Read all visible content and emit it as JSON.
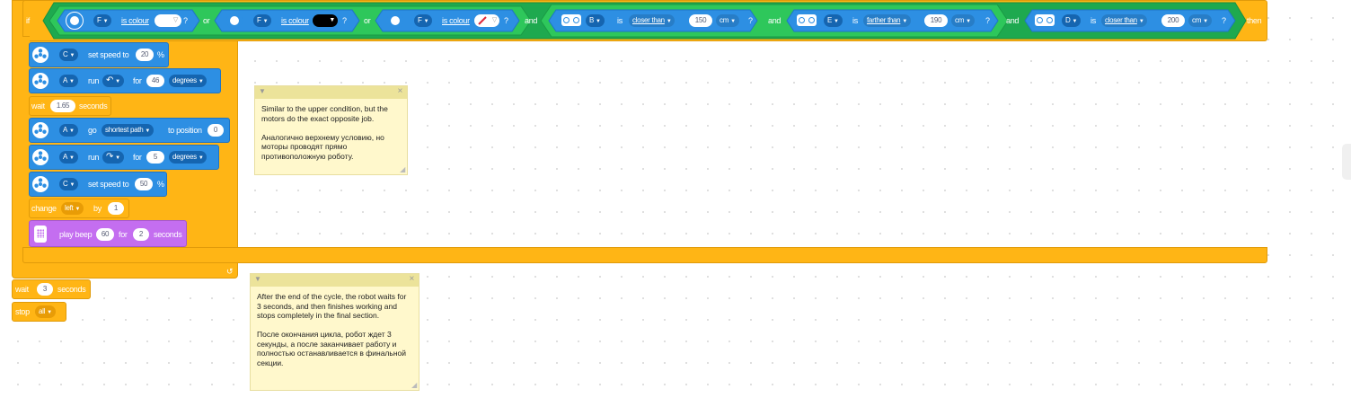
{
  "if_block": {
    "if_label": "if",
    "then_label": "then",
    "cond1": {
      "port": "F",
      "text": "is colour",
      "q": "?"
    },
    "or1": "or",
    "cond2": {
      "port": "F",
      "text": "is colour",
      "q": "?"
    },
    "or2": "or",
    "cond3": {
      "port": "F",
      "text": "is colour",
      "q": "?"
    },
    "and1": "and",
    "cond4": {
      "port": "B",
      "is": "is",
      "op": "closer than",
      "value": "150",
      "unit": "cm",
      "q": "?"
    },
    "and2": "and",
    "cond5": {
      "port": "E",
      "is": "is",
      "op": "farther than",
      "value": "190",
      "unit": "cm",
      "q": "?"
    },
    "and3": "and",
    "cond6": {
      "port": "D",
      "is": "is",
      "op": "closer than",
      "value": "200",
      "unit": "cm",
      "q": "?"
    }
  },
  "blocks": {
    "b1": {
      "port": "C",
      "text": "set speed to",
      "value": "20",
      "unit": "%"
    },
    "b2": {
      "port": "A",
      "run": "run",
      "for": "for",
      "value": "46",
      "unit": "degrees"
    },
    "b3": {
      "wait": "wait",
      "value": "1.65",
      "unit": "seconds"
    },
    "b4": {
      "port": "A",
      "go": "go",
      "path": "shortest path",
      "to": "to position",
      "value": "0"
    },
    "b5": {
      "port": "A",
      "run": "run",
      "for": "for",
      "value": "5",
      "unit": "degrees"
    },
    "b6": {
      "port": "C",
      "text": "set speed to",
      "value": "50",
      "unit": "%"
    },
    "b7": {
      "change": "change",
      "var": "left",
      "by": "by",
      "value": "1"
    },
    "b8": {
      "text": "play beep",
      "value": "60",
      "for": "for",
      "secs": "2",
      "unit": "seconds"
    },
    "loop_arrow": "↺",
    "wait2": {
      "wait": "wait",
      "value": "3",
      "unit": "seconds"
    },
    "stop": {
      "text": "stop",
      "value": "all"
    }
  },
  "notes": {
    "note1": "Similar to the upper condition, but the motors do the exact opposite job.\n\nАналогично верхнему условию, но моторы проводят прямо противоположную роботу.",
    "note2": "After the end of the cycle, the robot waits for 3 seconds, and then finishes working and stops completely in the final section.\n\nПосле окончания цикла, робот ждет 3 секунды, а после заканчивает работу и полностью останавливается в финальной секции."
  },
  "colors": {
    "control": "#ffb515",
    "motor": "#2d8fe3",
    "sensor": "#2ec75b",
    "sound": "#c46ef0",
    "note": "#fff8cc"
  },
  "icons": {
    "motor": "motor-icon",
    "color_sensor": "color-sensor-icon",
    "distance_sensor": "distance-sensor-icon",
    "hub": "hub-icon"
  }
}
